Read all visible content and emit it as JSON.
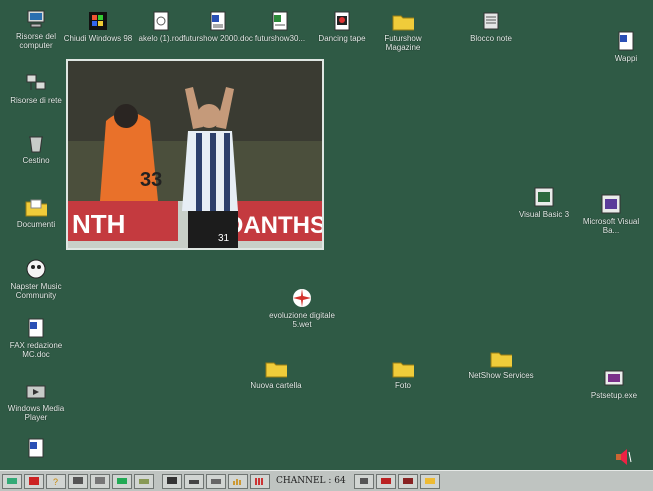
{
  "desktop": {
    "icons": [
      {
        "label": "Risorse del computer",
        "icon": "computer-icon"
      },
      {
        "label": "Chiudi Windows 98",
        "icon": "shutdown-icon"
      },
      {
        "label": "akelo (1).rod",
        "icon": "document-icon"
      },
      {
        "label": "futurshow 2000.doc",
        "icon": "word-doc-icon"
      },
      {
        "label": "futurshow30...",
        "icon": "spreadsheet-icon"
      },
      {
        "label": "Dancing tape",
        "icon": "media-file-icon"
      },
      {
        "label": "Futurshow Magazine",
        "icon": "folder-icon"
      },
      {
        "label": "Blocco note",
        "icon": "notepad-icon"
      },
      {
        "label": "Wappi",
        "icon": "word-doc-icon"
      },
      {
        "label": "Risorse di rete",
        "icon": "network-icon"
      },
      {
        "label": "Cestino",
        "icon": "recycle-bin-icon"
      },
      {
        "label": "Documenti",
        "icon": "my-documents-icon"
      },
      {
        "label": "Napster Music Community",
        "icon": "napster-icon"
      },
      {
        "label": "FAX redazione MC.doc",
        "icon": "word-doc-icon"
      },
      {
        "label": "Windows Media Player",
        "icon": "media-player-icon"
      },
      {
        "label": "Visual Basic 3",
        "icon": "visual-basic-icon"
      },
      {
        "label": "Microsoft Visual Ba...",
        "icon": "visual-basic-icon"
      },
      {
        "label": "evoluzione digitale 5.wet",
        "icon": "star-burst-icon"
      },
      {
        "label": "Nuova cartella",
        "icon": "folder-icon"
      },
      {
        "label": "Foto",
        "icon": "folder-icon"
      },
      {
        "label": "NetShow Services",
        "icon": "folder-icon"
      },
      {
        "label": "Pstsetup.exe",
        "icon": "installer-icon"
      },
      {
        "label": "",
        "icon": "word-doc-icon"
      }
    ]
  },
  "photo": {
    "banner_text_left": "NTH",
    "banner_text_right": "DANTHS",
    "jersey_number_left": "33",
    "jersey_number_right": "31"
  },
  "taskbar": {
    "channel_label": "CHANNEL : 64",
    "quick_launch_icons": [
      "network-icon",
      "help-icon",
      "question-icon",
      "tv-icon",
      "monitor-icon",
      "display-icon",
      "tool-icon"
    ],
    "media_icons": [
      "screen-icon",
      "scanner-icon",
      "printer-icon",
      "equalizer-icon",
      "bars-icon"
    ],
    "tray_icons": [
      "sound-icon",
      "camera-icon",
      "film-icon",
      "folder-icon"
    ]
  },
  "colors": {
    "desktop": "#2f5a45",
    "taskbar": "#bfc4c1",
    "folder": "#f0cc3a"
  }
}
